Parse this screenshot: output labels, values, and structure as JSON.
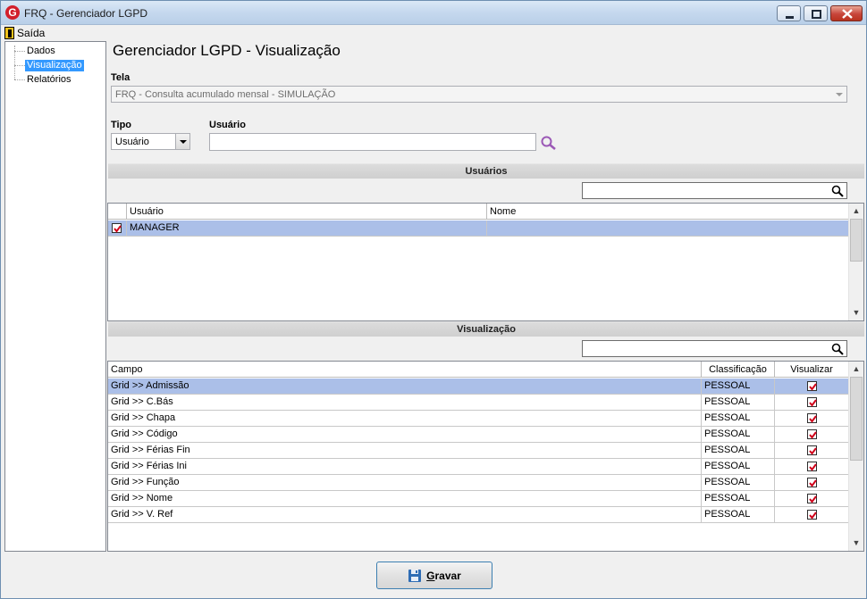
{
  "window": {
    "title": "FRQ - Gerenciador LGPD",
    "app_icon_letter": "G"
  },
  "menu": {
    "exit_label": "Saída"
  },
  "nav": {
    "items": [
      {
        "label": "Dados"
      },
      {
        "label": "Visualização",
        "active": true
      },
      {
        "label": "Relatórios"
      }
    ]
  },
  "main": {
    "title": "Gerenciador LGPD - Visualização",
    "tela_label": "Tela",
    "tela_value": "FRQ - Consulta acumulado mensal - SIMULAÇÃO",
    "tipo_label": "Tipo",
    "tipo_value": "Usuário",
    "usuario_label": "Usuário",
    "usuario_value": ""
  },
  "usuarios_section": {
    "header": "Usuários",
    "search_value": "",
    "columns": [
      "Usuário",
      "Nome"
    ],
    "rows": [
      {
        "checked": true,
        "usuario": "MANAGER",
        "nome": ""
      }
    ]
  },
  "visualizacao_section": {
    "header": "Visualização",
    "search_value": "",
    "columns": [
      "Campo",
      "Classificação",
      "Visualizar"
    ],
    "rows": [
      {
        "campo": "Grid >> Admissão",
        "classificacao": "PESSOAL",
        "visualizar": true
      },
      {
        "campo": "Grid >> C.Bás",
        "classificacao": "PESSOAL",
        "visualizar": true
      },
      {
        "campo": "Grid >> Chapa",
        "classificacao": "PESSOAL",
        "visualizar": true
      },
      {
        "campo": "Grid >> Código",
        "classificacao": "PESSOAL",
        "visualizar": true
      },
      {
        "campo": "Grid >> Férias Fin",
        "classificacao": "PESSOAL",
        "visualizar": true
      },
      {
        "campo": "Grid >> Férias Ini",
        "classificacao": "PESSOAL",
        "visualizar": true
      },
      {
        "campo": "Grid >> Função",
        "classificacao": "PESSOAL",
        "visualizar": true
      },
      {
        "campo": "Grid >> Nome",
        "classificacao": "PESSOAL",
        "visualizar": true
      },
      {
        "campo": "Grid >> V. Ref",
        "classificacao": "PESSOAL",
        "visualizar": true
      }
    ]
  },
  "footer": {
    "save_label_underlined": "G",
    "save_label_rest": "ravar"
  },
  "colors": {
    "selection": "#abbfe8",
    "nav_active": "#3399ff",
    "check": "#d0021b",
    "search_icon": "#9b59b6"
  }
}
